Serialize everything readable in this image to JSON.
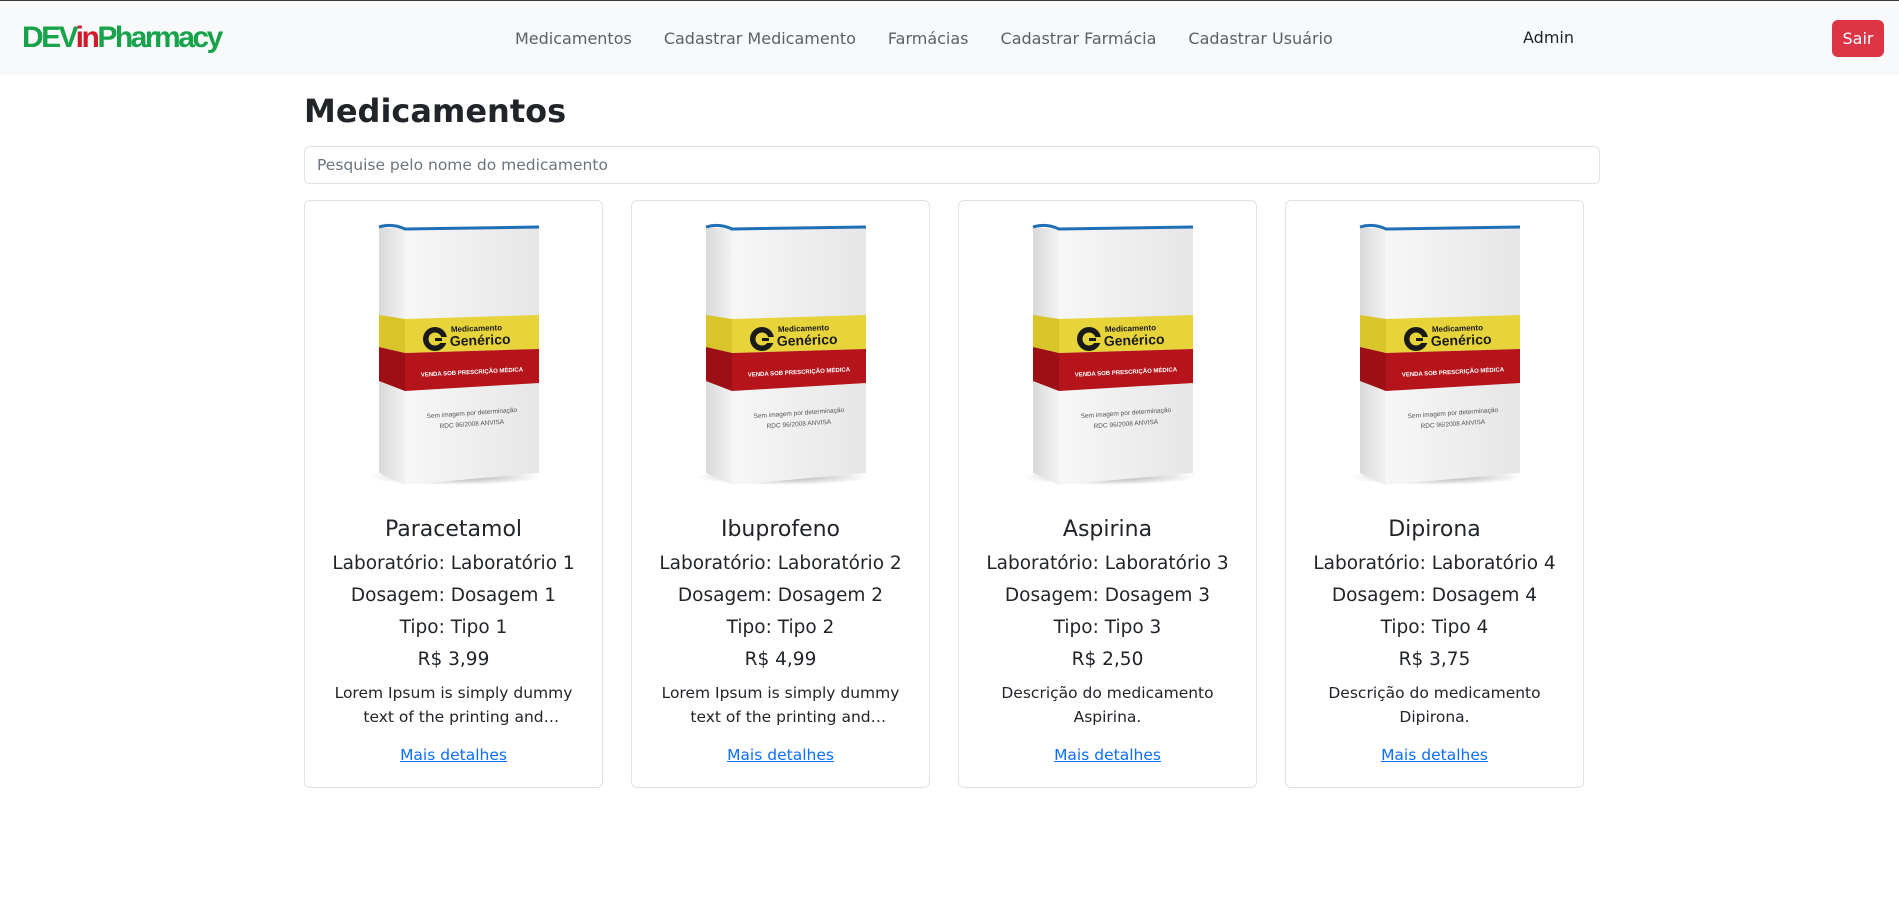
{
  "brand": {
    "part1": "DEV",
    "part2": "in",
    "part3": "Pharmacy"
  },
  "nav": {
    "links": [
      "Medicamentos",
      "Cadastrar Medicamento",
      "Farmácias",
      "Cadastrar Farmácia",
      "Cadastrar Usuário"
    ],
    "user": "Admin",
    "logout_label": "Sair"
  },
  "page": {
    "title": "Medicamentos",
    "search_placeholder": "Pesquise pelo nome do medicamento"
  },
  "package_art": {
    "brand_small": "Medicamento",
    "brand_big": "Genérico",
    "band_text": "VENDA SOB PRESCRIÇÃO MÉDICA",
    "note_line1": "Sem imagem por determinação",
    "note_line2": "RDC 96/2008 ANVISA"
  },
  "cards": [
    {
      "name": "Paracetamol",
      "laboratorio": "Laboratório: Laboratório 1",
      "dosagem": "Dosagem: Dosagem 1",
      "tipo": "Tipo: Tipo 1",
      "preco": "R$ 3,99",
      "descricao": "Lorem Ipsum is simply dummy text of the printing and typesetting industry.",
      "link": "Mais detalhes"
    },
    {
      "name": "Ibuprofeno",
      "laboratorio": "Laboratório: Laboratório 2",
      "dosagem": "Dosagem: Dosagem 2",
      "tipo": "Tipo: Tipo 2",
      "preco": "R$ 4,99",
      "descricao": "Lorem Ipsum is simply dummy text of the printing and typesetting industry.",
      "link": "Mais detalhes"
    },
    {
      "name": "Aspirina",
      "laboratorio": "Laboratório: Laboratório 3",
      "dosagem": "Dosagem: Dosagem 3",
      "tipo": "Tipo: Tipo 3",
      "preco": "R$ 2,50",
      "descricao": "Descrição do medicamento Aspirina.",
      "link": "Mais detalhes"
    },
    {
      "name": "Dipirona",
      "laboratorio": "Laboratório: Laboratório 4",
      "dosagem": "Dosagem: Dosagem 4",
      "tipo": "Tipo: Tipo 4",
      "preco": "R$ 3,75",
      "descricao": "Descrição do medicamento Dipirona.",
      "link": "Mais detalhes"
    }
  ],
  "colors": {
    "brand_green": "#17a34a",
    "brand_red": "#d11a2a",
    "danger": "#dc3545",
    "link": "#0d6efd"
  }
}
